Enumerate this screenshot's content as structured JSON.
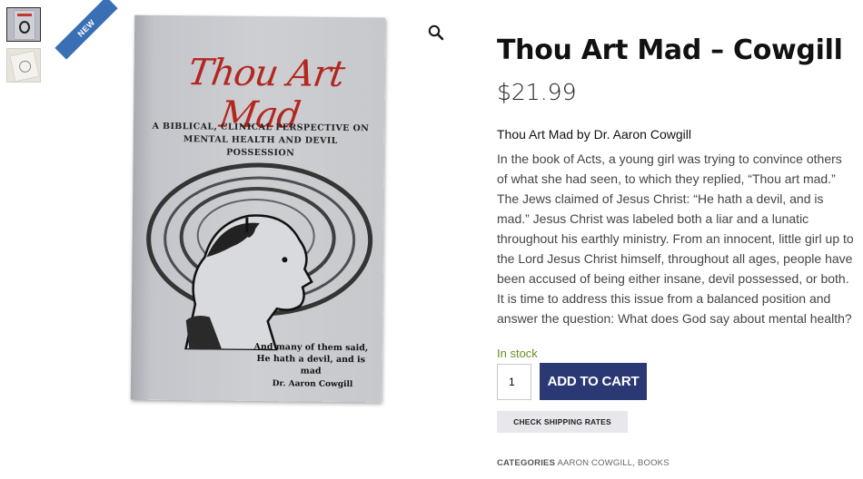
{
  "gallery": {
    "badge": "NEW",
    "cover": {
      "title": "Thou Art Mad",
      "subtitle": "A BIBLICAL, CLINICAL PERSPECTIVE ON MENTAL HEALTH AND DEVIL POSSESSION",
      "quote_line1": "And many of them said,",
      "quote_line2": "He hath a devil, and is mad",
      "author": "Dr. Aaron Cowgill"
    }
  },
  "product": {
    "title": "Thou Art Mad – Cowgill",
    "price": "$21.99",
    "lead": "Thou Art Mad by Dr. Aaron Cowgill",
    "description": "In the book of Acts, a young girl was trying to convince others of what she had seen, to which they replied, “Thou art mad.” The Jews claimed of Jesus Christ: “He hath a devil, and is mad.” Jesus Christ was labeled both a liar and a lunatic throughout his earthly ministry. From an innocent, little girl up to the Lord Jesus Christ himself, throughout all ages, people have been accused of being either insane, devil possessed, or both. It is time to address this issue from a balanced position and answer the question: What does God say about mental health?",
    "stock": "In stock",
    "quantity": "1",
    "add_to_cart": "ADD TO CART",
    "check_shipping": "CHECK SHIPPING RATES",
    "categories_label": "CATEGORIES",
    "categories": [
      "AARON COWGILL",
      "BOOKS"
    ],
    "category_separator": ", "
  },
  "colors": {
    "accent": "#2a3874",
    "ribbon": "#3a6fb5",
    "stock": "#6b8e23",
    "cover_title": "#b3271f"
  }
}
